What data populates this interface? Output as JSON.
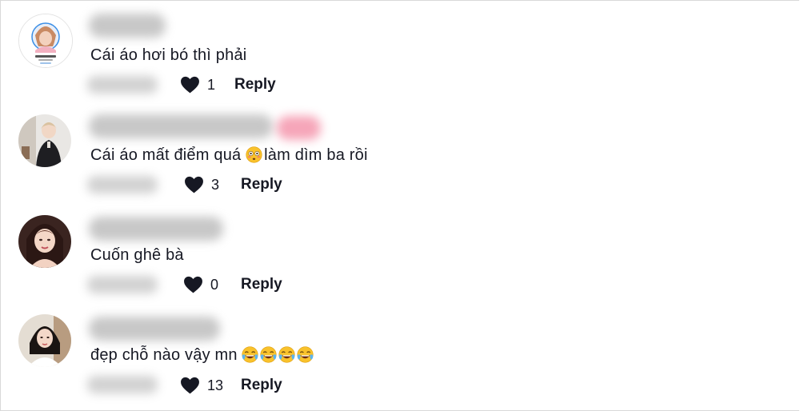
{
  "comments": [
    {
      "avatar": "avatar-woman-light-hair",
      "avatar_caption": "An Nguyễn",
      "text": "Cái áo hơi bó thì phải",
      "emojis": [],
      "likes": "1",
      "reply_label": "Reply"
    },
    {
      "avatar": "avatar-woman-dark-outfit",
      "text_before": "Cái áo mất điểm quá ",
      "text_after": "làm dìm ba rồi",
      "emojis": [
        "flushed-face"
      ],
      "likes": "3",
      "reply_label": "Reply"
    },
    {
      "avatar": "avatar-woman-closeup",
      "text": "Cuốn ghê bà",
      "emojis": [],
      "likes": "0",
      "reply_label": "Reply"
    },
    {
      "avatar": "avatar-woman-white-top",
      "text": "đẹp chỗ nào vậy mn ",
      "emojis": [
        "tears-of-joy",
        "tears-of-joy",
        "tears-of-joy",
        "tears-of-joy"
      ],
      "likes": "13",
      "reply_label": "Reply"
    }
  ],
  "colors": {
    "text": "#161823",
    "heart": "#161823",
    "blurred_name": "#9a9a9a",
    "blurred_name_pink": "#f06a8a",
    "border": "#d9d9d9"
  }
}
